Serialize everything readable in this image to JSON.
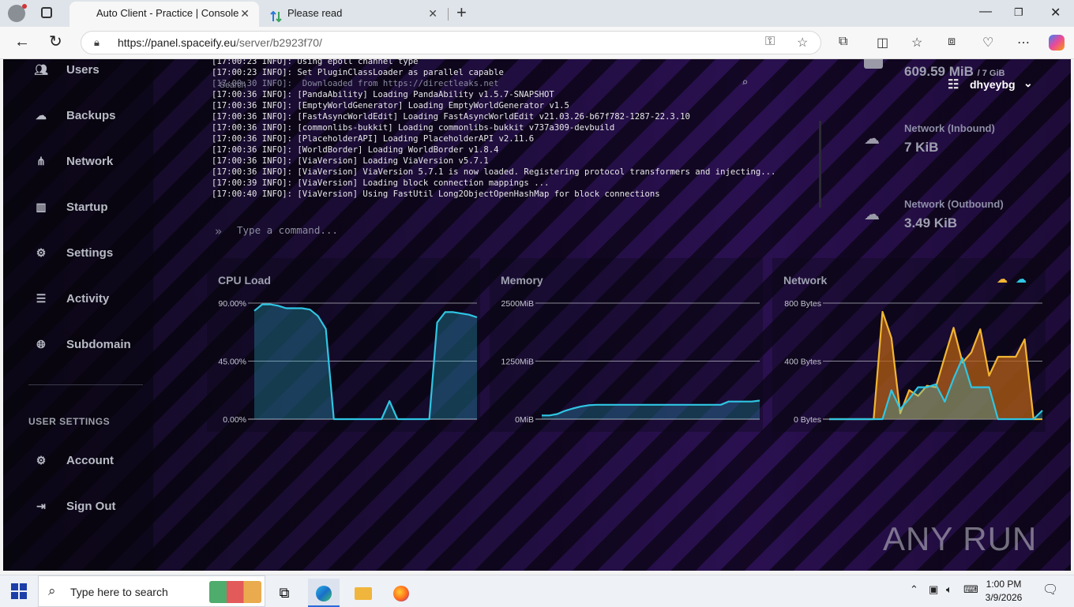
{
  "browser": {
    "tabs": [
      {
        "title": "Auto Client - Practice | Console",
        "active": true
      },
      {
        "title": "Please read",
        "active": false
      }
    ],
    "url_host": "https://panel.spaceify.eu",
    "url_path": "/server/b2923f70/"
  },
  "sidebar": {
    "items": [
      {
        "label": "Users",
        "icon": "users-icon"
      },
      {
        "label": "Backups",
        "icon": "cloud-icon"
      },
      {
        "label": "Network",
        "icon": "network-icon"
      },
      {
        "label": "Startup",
        "icon": "chart-icon"
      },
      {
        "label": "Settings",
        "icon": "gears-icon"
      },
      {
        "label": "Activity",
        "icon": "list-icon"
      },
      {
        "label": "Subdomain",
        "icon": "globe-icon"
      }
    ],
    "user_settings_heading": "USER SETTINGS",
    "user_items": [
      {
        "label": "Account",
        "icon": "gears-icon"
      },
      {
        "label": "Sign Out",
        "icon": "sign-out-icon"
      }
    ]
  },
  "console": {
    "lines": [
      "[17:00:23 INFO]: Using epoll channel type",
      "[17:00:23 INFO]: Set PluginClassLoader as parallel capable",
      "[17:00:36 INFO]: [PandaAbility] Loading PandaAbility v1.5.7-SNAPSHOT",
      "[17:00:36 INFO]: [EmptyWorldGenerator] Loading EmptyWorldGenerator v1.5",
      "[17:00:36 INFO]: [FastAsyncWorldEdit] Loading FastAsyncWorldEdit v21.03.26-b67f782-1287-22.3.10",
      "[17:00:36 INFO]: [commonlibs-bukkit] Loading commonlibs-bukkit v737a309-devbuild",
      "[17:00:36 INFO]: [PlaceholderAPI] Loading PlaceholderAPI v2.11.6",
      "[17:00:36 INFO]: [WorldBorder] Loading WorldBorder v1.8.4",
      "[17:00:36 INFO]: [ViaVersion] Loading ViaVersion v5.7.1",
      "[17:00:36 INFO]: [ViaVersion] ViaVersion 5.7.1 is now loaded. Registering protocol transformers and injecting...",
      "[17:00:39 INFO]: [ViaVersion] Loading block connection mappings ...",
      "[17:00:40 INFO]: [ViaVersion] Using FastUtil Long2ObjectOpenHashMap for block connections"
    ],
    "ghost_line": "[17:00:30 INFO]:  Downloaded from https://directleaks.net",
    "ghost_search": "Search",
    "command_placeholder": "Type a command..."
  },
  "stats": {
    "memory_value": "609.59 MiB",
    "memory_limit": "/ 7 GiB",
    "network_in_label": "Network (Inbound)",
    "network_in_value": "7 KiB",
    "network_out_label": "Network (Outbound)",
    "network_out_value": "3.49 KiB"
  },
  "user": {
    "name": "dhyeybg"
  },
  "watermark": "ANY RUN",
  "taskbar": {
    "search_placeholder": "Type here to search",
    "time": "1:00 PM",
    "date": "3/9/2026"
  },
  "colors": {
    "cpu_line": "#2fc6e3",
    "net_in": "#f2b632",
    "net_out": "#2fc6e3"
  },
  "chart_data": [
    {
      "type": "area",
      "title": "CPU Load",
      "y_ticks": [
        "90.00%",
        "45.00%",
        "0.00%"
      ],
      "ylim": [
        0,
        90
      ],
      "series": [
        {
          "values": [
            84,
            89,
            89,
            88,
            86,
            86,
            86,
            85,
            80,
            70,
            0,
            0,
            0,
            0,
            0,
            0,
            0,
            14,
            0,
            0,
            0,
            0,
            0,
            75,
            83,
            83,
            82,
            81,
            79
          ]
        }
      ]
    },
    {
      "type": "area",
      "title": "Memory",
      "y_ticks": [
        "2500MiB",
        "1250MiB",
        "0MiB"
      ],
      "ylim": [
        0,
        2500
      ],
      "series": [
        {
          "values": [
            80,
            80,
            110,
            180,
            230,
            270,
            300,
            310,
            310,
            310,
            310,
            310,
            310,
            310,
            310,
            310,
            310,
            310,
            310,
            310,
            310,
            310,
            310,
            310,
            380,
            380,
            380,
            380,
            400
          ]
        }
      ]
    },
    {
      "type": "area",
      "title": "Network",
      "y_ticks": [
        "800 Bytes",
        "400 Bytes",
        "0 Bytes"
      ],
      "ylim": [
        0,
        800
      ],
      "series": [
        {
          "values": [
            0,
            0,
            0,
            0,
            0,
            0,
            740,
            560,
            40,
            200,
            160,
            230,
            220,
            430,
            630,
            390,
            460,
            620,
            300,
            430,
            430,
            430,
            550,
            0,
            0
          ]
        },
        {
          "values": [
            0,
            0,
            0,
            0,
            0,
            0,
            0,
            200,
            70,
            140,
            220,
            220,
            240,
            120,
            280,
            420,
            220,
            220,
            220,
            0,
            0,
            0,
            0,
            0,
            60
          ]
        }
      ]
    }
  ]
}
